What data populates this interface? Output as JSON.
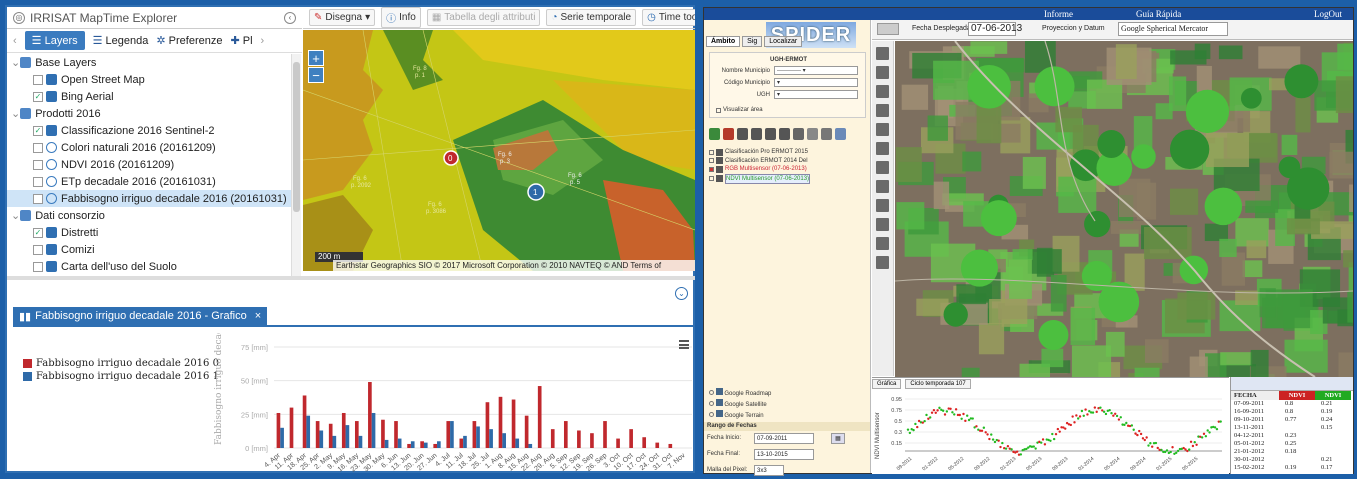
{
  "left_app": {
    "title": "IRRISAT MapTime Explorer",
    "tabs": [
      "Layers",
      "Legenda",
      "Preferenze",
      "Pl"
    ],
    "tree": [
      {
        "label": "Base Layers",
        "level": 0,
        "type": "folder",
        "checked": null
      },
      {
        "label": "Open Street Map",
        "level": 1,
        "type": "layer",
        "checked": false
      },
      {
        "label": "Bing Aerial",
        "level": 1,
        "type": "layer",
        "checked": true
      },
      {
        "label": "Prodotti 2016",
        "level": 0,
        "type": "folder",
        "checked": null
      },
      {
        "label": "Classificazione 2016 Sentinel-2",
        "level": 1,
        "type": "layer",
        "checked": true
      },
      {
        "label": "Colori naturali 2016 (20161209)",
        "level": 1,
        "type": "time",
        "checked": false
      },
      {
        "label": "NDVI 2016 (20161209)",
        "level": 1,
        "type": "time",
        "checked": false
      },
      {
        "label": "ETp decadale 2016 (20161031)",
        "level": 1,
        "type": "time",
        "checked": false
      },
      {
        "label": "Fabbisogno irriguo decadale 2016 (20161031)",
        "level": 1,
        "type": "time",
        "checked": false,
        "selected": true
      },
      {
        "label": "Dati consorzio",
        "level": 0,
        "type": "folder",
        "checked": null
      },
      {
        "label": "Distretti",
        "level": 1,
        "type": "layer",
        "checked": true
      },
      {
        "label": "Comizi",
        "level": 1,
        "type": "layer",
        "checked": false
      },
      {
        "label": "Carta dell'uso del Suolo",
        "level": 1,
        "type": "layer",
        "checked": false
      }
    ],
    "map_toolbar": [
      "Disegna",
      "Info",
      "Tabella degli attributi",
      "Serie temporale",
      "Time tools"
    ],
    "map": {
      "scale": "200 m",
      "attribution": "Earthstar Geographics SIO © 2017 Microsoft Corporation © 2010 NAVTEQ © AND Terms of",
      "markers": [
        "0",
        "1"
      ],
      "labels": [
        "Fg. 6",
        "p. 3",
        "Fg. 6",
        "p. 5",
        "Fg. 6",
        "p. 2092",
        "Fg. 6",
        "p. 3086",
        "Fg. 8",
        "p. 1"
      ]
    },
    "chart_tab_label": "Fabbisogno irriguo decadale 2016 - Grafico",
    "chart_data": {
      "type": "bar",
      "ylabel": "Fabbisogno irriguo decadale 2016",
      "ylim": [
        0,
        75
      ],
      "yticks": [
        "0 [mm]",
        "25 [mm]",
        "50 [mm]",
        "75 [mm]"
      ],
      "categories": [
        "4. Apr",
        "11. Apr",
        "18. Apr",
        "25. Apr",
        "2. May",
        "9. May",
        "16. May",
        "23. May",
        "30. May",
        "6. Jun",
        "13. Jun",
        "20. Jun",
        "27. Jun",
        "4. Jul",
        "11. Jul",
        "18. Jul",
        "25. Jul",
        "1. Aug",
        "8. Aug",
        "15. Aug",
        "22. Aug",
        "29. Aug",
        "5. Sep",
        "12. Sep",
        "19. Sep",
        "26. Sep",
        "3. Oct",
        "10. Oct",
        "17. Oct",
        "24. Oct",
        "31. Oct",
        "7. Nov"
      ],
      "tick_labels": [
        "4. Apr",
        "11. Apr",
        "18. Apr",
        "25. Apr",
        "2. May",
        "9. May",
        "16. May",
        "23. May",
        "30. May",
        "6. Jun",
        "13. Jun",
        "20. Jun",
        "27. Jun",
        "4. Jul",
        "11. Jul",
        "18. Jul",
        "25. Jul",
        "1. Aug",
        "8. Aug",
        "15. Aug",
        "22. Aug",
        "29. Aug",
        "5. Sep",
        "12. Sep",
        "19. Sep",
        "26. Sep",
        "3. Oct",
        "10. Oct",
        "17. Oct",
        "24. Oct",
        "31. Oct",
        "7. Nov"
      ],
      "series": [
        {
          "name": "Fabbisogno irriguo decadale 2016 0",
          "color": "#c0282d",
          "values": [
            26,
            30,
            39,
            20,
            18,
            26,
            20,
            49,
            21,
            20,
            3,
            5,
            3,
            20,
            7,
            20,
            34,
            38,
            36,
            24,
            46,
            14,
            20,
            13,
            11,
            20,
            7,
            14,
            8,
            4,
            3,
            0
          ]
        },
        {
          "name": "Fabbisogno irriguo decadale 2016 1",
          "color": "#2e6aa8",
          "values": [
            15,
            0,
            24,
            13,
            9,
            17,
            9,
            26,
            6,
            7,
            5,
            4,
            5,
            20,
            9,
            16,
            14,
            11,
            7,
            3,
            0,
            0,
            0,
            0,
            0,
            0,
            0,
            0,
            0,
            0,
            0,
            0
          ]
        }
      ]
    }
  },
  "right_app": {
    "menu": [
      "Informe",
      "Guía Rápida",
      "LogOut"
    ],
    "brand": "SPIDER",
    "tabs": [
      "Ámbito",
      "Sig",
      "Localizar"
    ],
    "ugh_title": "UGH-ERMOT",
    "form_labels": [
      "Nombre Municipio",
      "Código Municipio",
      "UGH"
    ],
    "visualizar": "Visualizar área",
    "layers": [
      "Clasificación Pro ERMOT 2015",
      "Clasificación ERMOT 2014 Del",
      "RGB Multisensor (07-06-2013)",
      "NDVI Multisensor (07-06-2013)"
    ],
    "base_layers": [
      "Google Roadmap",
      "Google Satellite",
      "Google Terrain"
    ],
    "rango": "Rango de Fechas",
    "fecha_inicio_label": "Fecha Inicio:",
    "fecha_inicio": "07-09-2011",
    "fecha_final_label": "Fecha Final:",
    "fecha_final": "13-10-2015",
    "malla_label": "Malla del Pixel:",
    "malla": "3x3",
    "fecha_desplegada_label": "Fecha Desplegada",
    "fecha_desplegada": "07-06-2013",
    "proyeccion_label": "Proyeccion y Datum",
    "proyeccion": "Google Spherical Mercator",
    "ndvi_tabs": [
      "Gráfica",
      "Ciclo temporada 107"
    ],
    "ndvi_ylabel": "NDVI Multisensor",
    "ndvi_yticks": [
      "0.95",
      "0.75",
      "0.5",
      "0.3",
      "0.15"
    ],
    "ndvi_xticks": [
      "09-2011",
      "01-2012",
      "05-2012",
      "09-2012",
      "01-2013",
      "05-2013",
      "09-2013",
      "01-2014",
      "05-2014",
      "09-2014",
      "01-2015",
      "05-2015"
    ],
    "table_cols": [
      "FECHA",
      "NDVI",
      "NDVI"
    ],
    "table_rows": [
      [
        "07-09-2011",
        "0.8",
        "0.21"
      ],
      [
        "16-09-2011",
        "0.8",
        "0.19"
      ],
      [
        "09-10-2011",
        "0.77",
        "0.24"
      ],
      [
        "13-11-2011",
        "",
        "0.15"
      ],
      [
        "04-12-2011",
        "0.23",
        ""
      ],
      [
        "05-01-2012",
        "0.25",
        ""
      ],
      [
        "21-01-2012",
        "0.18",
        ""
      ],
      [
        "30-01-2012",
        "",
        "0.21"
      ],
      [
        "15-02-2012",
        "0.19",
        "0.17"
      ]
    ]
  }
}
